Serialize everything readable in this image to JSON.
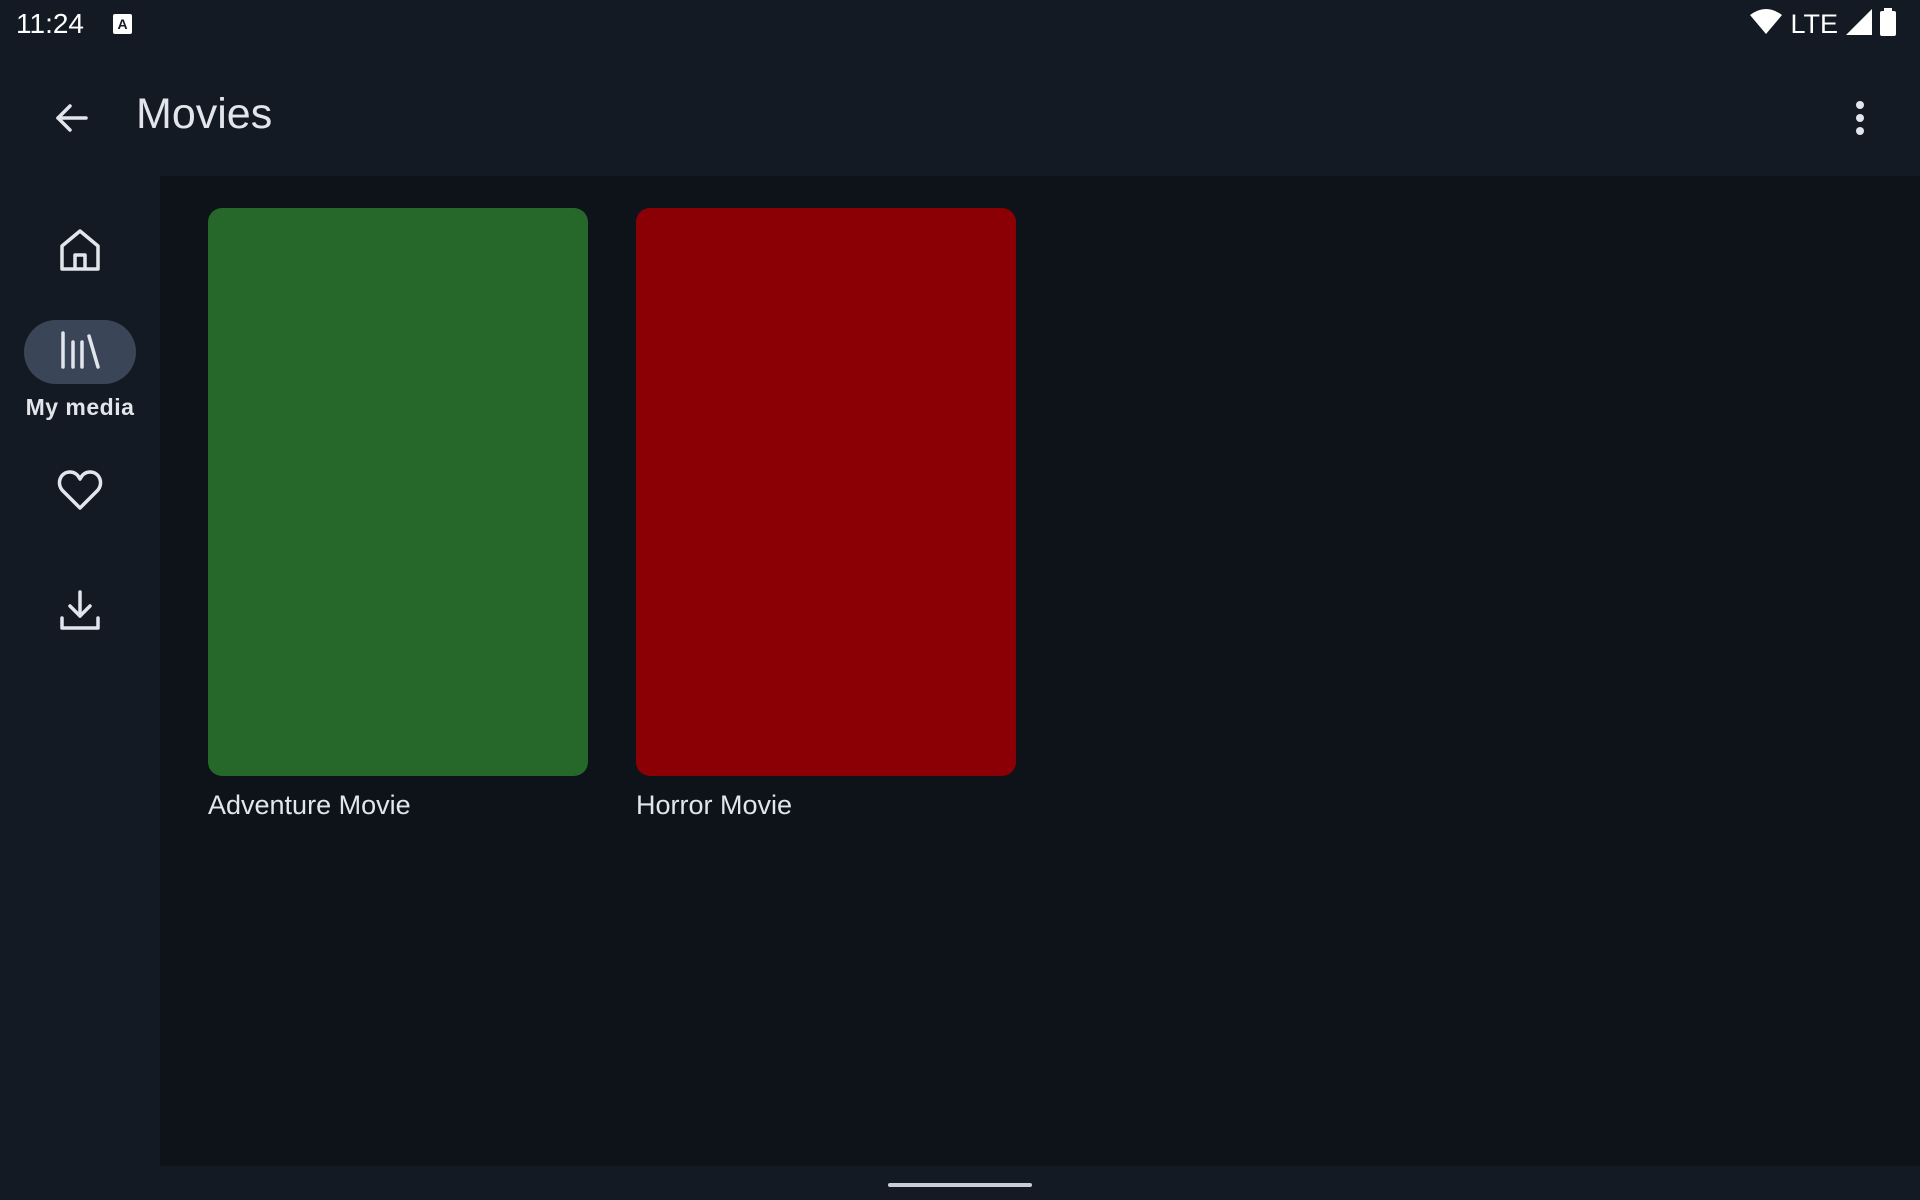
{
  "status_bar": {
    "time": "11:24",
    "notification_icon": "a-badge-icon",
    "network": "LTE"
  },
  "app_bar": {
    "title": "Movies",
    "back_icon": "arrow-left-icon",
    "menu_icon": "more-vert-icon"
  },
  "nav_rail": {
    "items": [
      {
        "icon": "home-icon",
        "label": "",
        "active": false
      },
      {
        "icon": "library-icon",
        "label": "My media",
        "active": true
      },
      {
        "icon": "heart-icon",
        "label": "",
        "active": false
      },
      {
        "icon": "download-icon",
        "label": "",
        "active": false
      }
    ]
  },
  "content": {
    "items": [
      {
        "title": "Adventure Movie",
        "color": "#256829"
      },
      {
        "title": "Horror Movie",
        "color": "#8b0005"
      }
    ]
  },
  "colors": {
    "background": "#131a23",
    "content_background": "#0e131a",
    "active_indicator": "#3a4658",
    "text": "#e2e6ec"
  }
}
